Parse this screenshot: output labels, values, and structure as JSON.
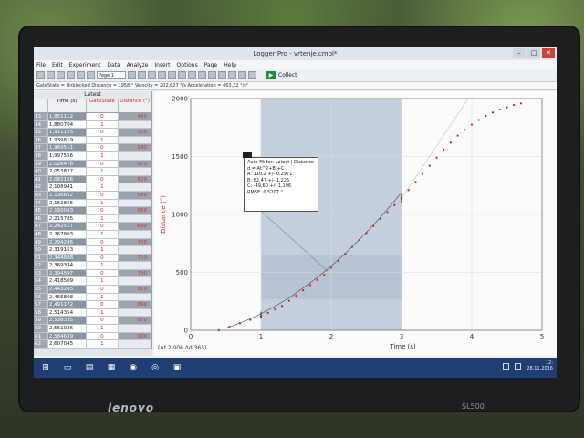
{
  "window": {
    "title": "Logger Pro - vrtenje.cmbl*"
  },
  "menu": [
    "File",
    "Edit",
    "Experiment",
    "Data",
    "Analyze",
    "Insert",
    "Options",
    "Page",
    "Help"
  ],
  "toolbar": {
    "page_selector": "Page 1",
    "collect_label": "Collect"
  },
  "status_line": "GateState = Unblocked  Distance = 1958 °  Velocity = 202,627 °/s  Acceleration = 463,32 °/s²",
  "table": {
    "group_title": "Latest",
    "columns": [
      "Time (s)",
      "GateState",
      "Distance (°)"
    ],
    "rows": [
      [
        "33",
        "1,851112",
        "0",
        "480"
      ],
      [
        "34",
        "1,880704",
        "1",
        ""
      ],
      [
        "35",
        "1,911155",
        "0",
        "510"
      ],
      [
        "36",
        "1,939819",
        "1",
        ""
      ],
      [
        "37",
        "1,969511",
        "0",
        "540"
      ],
      [
        "38",
        "1,997556",
        "1",
        ""
      ],
      [
        "39",
        "2,026478",
        "0",
        "570"
      ],
      [
        "40",
        "2,053827",
        "1",
        ""
      ],
      [
        "41",
        "2,082156",
        "0",
        "600"
      ],
      [
        "42",
        "2,108941",
        "1",
        ""
      ],
      [
        "43",
        "2,136652",
        "0",
        "630"
      ],
      [
        "44",
        "2,162855",
        "1",
        ""
      ],
      [
        "45",
        "2,190043",
        "0",
        "660"
      ],
      [
        "46",
        "2,215785",
        "1",
        ""
      ],
      [
        "47",
        "2,242517",
        "0",
        "690"
      ],
      [
        "48",
        "2,267803",
        "1",
        ""
      ],
      [
        "49",
        "2,294246",
        "0",
        "720"
      ],
      [
        "50",
        "2,319153",
        "1",
        ""
      ],
      [
        "51",
        "2,344888",
        "0",
        "750"
      ],
      [
        "52",
        "2,369334",
        "1",
        ""
      ],
      [
        "53",
        "2,394597",
        "0",
        "780"
      ],
      [
        "54",
        "2,418509",
        "1",
        ""
      ],
      [
        "55",
        "2,443245",
        "0",
        "810"
      ],
      [
        "56",
        "2,466808",
        "1",
        ""
      ],
      [
        "57",
        "2,491172",
        "0",
        "840"
      ],
      [
        "58",
        "2,514354",
        "1",
        ""
      ],
      [
        "59",
        "2,538335",
        "0",
        "870"
      ],
      [
        "60",
        "2,561026",
        "1",
        ""
      ],
      [
        "61",
        "2,584639",
        "0",
        "900"
      ],
      [
        "62",
        "2,607045",
        "1",
        ""
      ]
    ]
  },
  "graph": {
    "ylabel": "Distance (°)",
    "xlabel": "Time (s)",
    "delta_readout": "(Δt 2,006 Δd 365)"
  },
  "fit": {
    "title": "Auto Fit for: Latest | Distance",
    "equation": "d = At^2+Bt+C",
    "A": "A: 110,2 +/- 0,2971",
    "B": "B: 82,47 +/- 1,225",
    "C": "C: -49,60 +/- 1,196",
    "rmse": "RMSE: 0,5207 °"
  },
  "chart_data": {
    "type": "scatter",
    "xlabel": "Time (s)",
    "ylabel": "Distance (°)",
    "xlim": [
      0,
      5
    ],
    "ylim": [
      0,
      2000
    ],
    "xticks": [
      "0",
      "1",
      "2",
      "3",
      "4",
      "5"
    ],
    "yticks": [
      "0",
      "500",
      "1000",
      "1500",
      "2000"
    ],
    "selection_x": [
      1.0,
      3.0
    ],
    "grid": true,
    "series": [
      {
        "color": "#cc2222",
        "x": [
          0.4,
          0.55,
          0.7,
          0.85,
          1.0,
          1.1,
          1.2,
          1.3,
          1.4,
          1.5,
          1.6,
          1.7,
          1.8,
          1.9,
          2.0,
          2.1,
          2.2,
          2.3,
          2.4,
          2.5,
          2.6,
          2.7,
          2.8,
          2.9,
          3.0,
          3.1,
          3.2,
          3.3,
          3.4,
          3.5,
          3.6,
          3.7,
          3.8,
          3.9,
          4.0,
          4.1,
          4.2,
          4.3,
          4.4,
          4.5,
          4.6,
          4.7
        ],
        "y": [
          0,
          30,
          60,
          90,
          120,
          150,
          180,
          210,
          255,
          300,
          345,
          390,
          435,
          480,
          540,
          600,
          660,
          720,
          780,
          840,
          900,
          960,
          1020,
          1080,
          1140,
          1210,
          1280,
          1350,
          1420,
          1490,
          1560,
          1620,
          1680,
          1730,
          1775,
          1815,
          1850,
          1880,
          1905,
          1925,
          1945,
          1958
        ]
      }
    ]
  },
  "taskbar": {
    "clock_time": "12:",
    "clock_date": "28.11.2016"
  }
}
